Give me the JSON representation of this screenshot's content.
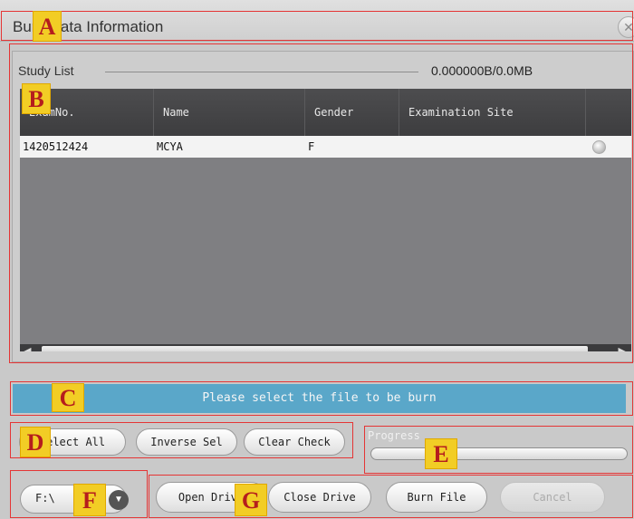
{
  "window": {
    "title": "Burn Data Information",
    "close_glyph": "✕"
  },
  "study_list": {
    "label": "Study List",
    "size_info": "0.000000B/0.0MB",
    "columns": [
      "ExamNo.",
      "Name",
      "Gender",
      "Examination Site"
    ],
    "rows": [
      {
        "exam_no": "1420512424",
        "name": "MCYA",
        "gender": "F",
        "examination_site": ""
      }
    ]
  },
  "status": {
    "message": "Please select the file to be burn"
  },
  "selection_buttons": {
    "select_all": "Select All",
    "inverse_sel": "Inverse Sel",
    "clear_check": "Clear Check"
  },
  "progress": {
    "label": "Progress",
    "value": 0
  },
  "drive": {
    "value": "F:\\",
    "arrow_glyph": "▼"
  },
  "drive_buttons": {
    "open_drive": "Open Drive",
    "close_drive": "Close Drive",
    "burn_file": "Burn File",
    "cancel": "Cancel"
  },
  "markers": {
    "A": "A",
    "B": "B",
    "C": "C",
    "D": "D",
    "E": "E",
    "F": "F",
    "G": "G"
  },
  "colors": {
    "status_bar": "#5aa7c9",
    "marker_bg": "#f2cd25",
    "marker_text": "#b51d1d",
    "annotation_box": "#e53535"
  }
}
